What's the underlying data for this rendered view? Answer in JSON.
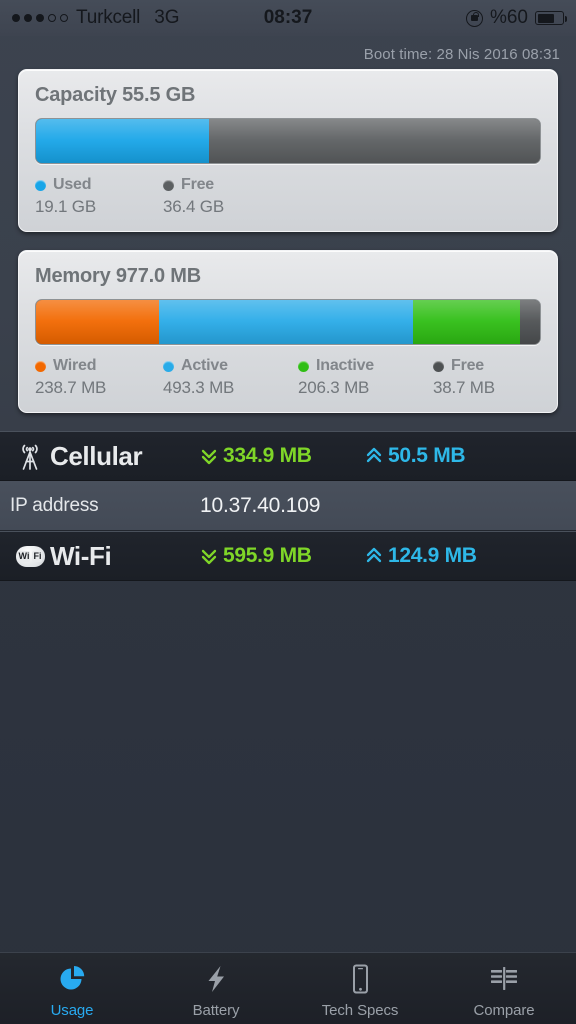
{
  "status_bar": {
    "signal_dots_filled": 3,
    "signal_dots_total": 5,
    "carrier": "Turkcell",
    "network_type": "3G",
    "time": "08:37",
    "battery_percent_label": "%60",
    "battery_level": 60,
    "rotation_lock_icon": "rotation-lock-icon"
  },
  "boot_time": "Boot time: 28 Nis 2016 08:31",
  "capacity_card": {
    "title": "Capacity 55.5 GB",
    "total_gb": 55.5,
    "segments": [
      {
        "label": "Used",
        "value": "19.1 GB",
        "amount_gb": 19.1,
        "percent": 34.4,
        "color": "#18a5e8"
      },
      {
        "label": "Free",
        "value": "36.4 GB",
        "amount_gb": 36.4,
        "percent": 65.6,
        "color": "#5c5f61"
      }
    ]
  },
  "memory_card": {
    "title": "Memory 977.0 MB",
    "total_mb": 977.0,
    "segments": [
      {
        "label": "Wired",
        "value": "238.7 MB",
        "amount_mb": 238.7,
        "percent": 24.4,
        "color": "#f26800"
      },
      {
        "label": "Active",
        "value": "493.3 MB",
        "amount_mb": 493.3,
        "percent": 50.5,
        "color": "#29abe8"
      },
      {
        "label": "Inactive",
        "value": "206.3 MB",
        "amount_mb": 206.3,
        "percent": 21.1,
        "color": "#2fbe14"
      },
      {
        "label": "Free",
        "value": "38.7 MB",
        "amount_mb": 38.7,
        "percent": 4.0,
        "color": "#4e5153"
      }
    ]
  },
  "network": {
    "cellular": {
      "icon": "cell-tower-icon",
      "name": "Cellular",
      "download": "334.9 MB",
      "upload": "50.5 MB",
      "download_color": "#7fd628",
      "upload_color": "#2eb8e8"
    },
    "ip_row": {
      "label": "IP address",
      "value": "10.37.40.109"
    },
    "wifi": {
      "icon": "wifi-badge-icon",
      "name": "Wi-Fi",
      "badge_text_1": "Wi",
      "badge_text_2": "Fi",
      "download": "595.9 MB",
      "upload": "124.9 MB",
      "download_color": "#7fd628",
      "upload_color": "#2eb8e8"
    }
  },
  "tab_bar": {
    "active_color": "#28aaf0",
    "inactive_color": "#9aa0a8",
    "tabs": [
      {
        "label": "Usage",
        "icon": "pie-chart-icon",
        "active": true
      },
      {
        "label": "Battery",
        "icon": "lightning-bolt-icon",
        "active": false
      },
      {
        "label": "Tech Specs",
        "icon": "phone-icon",
        "active": false
      },
      {
        "label": "Compare",
        "icon": "compare-bars-icon",
        "active": false
      }
    ]
  }
}
